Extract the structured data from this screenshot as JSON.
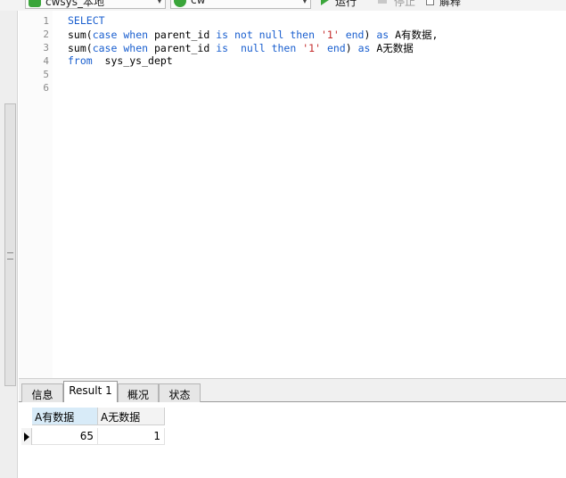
{
  "toolbar": {
    "connection": "cwsys_本地",
    "database": "cw",
    "run_label": "运行",
    "run_dropdown": "▾",
    "stop_label": "停止",
    "explain_label": "解释",
    "colors": {
      "connection_icon": "#3aa53a",
      "database_icon": "#3aa53a"
    }
  },
  "editor": {
    "line_numbers": [
      "1",
      "2",
      "3",
      "4",
      "5",
      "6"
    ],
    "lines": {
      "l1": {
        "kw": "SELECT"
      },
      "l2": {
        "a": "sum(",
        "kw1": "case",
        "b": " ",
        "kw2": "when",
        "c": " parent_id ",
        "kw3": "is not null",
        "d": " ",
        "kw4": "then",
        "e": " ",
        "str": "'1'",
        "f": " ",
        "kw5": "end",
        "g": ") ",
        "kw6": "as",
        "h": " A有数据,"
      },
      "l3": {
        "a": "sum(",
        "kw1": "case",
        "b": " ",
        "kw2": "when",
        "c": " parent_id ",
        "kw3": "is",
        "d": "  ",
        "kw4": "null",
        "e": " ",
        "kw5": "then",
        "f": " ",
        "str": "'1'",
        "g": " ",
        "kw6": "end",
        "h": ") ",
        "kw7": "as",
        "i": " A无数据"
      },
      "l4": {
        "kw": "from",
        "a": "  sys_ys_dept"
      }
    },
    "colors": {
      "keyword": "#1a5fcf",
      "string": "#c42b2b"
    }
  },
  "result_tabs": [
    "信息",
    "Result 1",
    "概况",
    "状态"
  ],
  "active_tab": "Result 1",
  "result_grid": {
    "columns": [
      "A有数据",
      "A无数据"
    ],
    "rows": [
      [
        "65",
        "1"
      ]
    ]
  }
}
